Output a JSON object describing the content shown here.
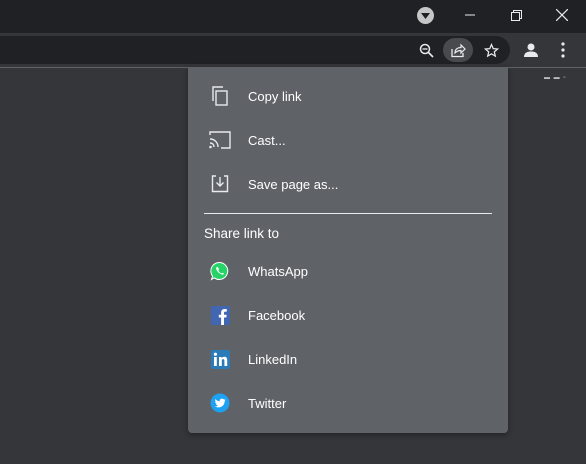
{
  "window": {
    "tab_search_icon": "chevron-down-icon",
    "minimize_icon": "minimize-icon",
    "restore_icon": "restore-icon",
    "close_icon": "close-icon"
  },
  "toolbar": {
    "zoom_icon": "zoom-out-icon",
    "share_icon": "share-icon",
    "bookmark_icon": "star-icon",
    "profile_icon": "person-icon",
    "menu_icon": "more-vertical-icon"
  },
  "share_menu": {
    "items": [
      {
        "label": "Copy link",
        "icon": "copy-icon"
      },
      {
        "label": "Cast...",
        "icon": "cast-icon"
      },
      {
        "label": "Save page as...",
        "icon": "download-icon"
      }
    ],
    "share_heading": "Share link to",
    "share_targets": [
      {
        "label": "WhatsApp",
        "icon": "whatsapp-icon",
        "color": "#25d366"
      },
      {
        "label": "Facebook",
        "icon": "facebook-icon",
        "color": "#4267b2"
      },
      {
        "label": "LinkedIn",
        "icon": "linkedin-icon",
        "color": "#2b7bb9"
      },
      {
        "label": "Twitter",
        "icon": "twitter-icon",
        "color": "#1da1f2"
      }
    ]
  },
  "colors": {
    "titlebar": "#202124",
    "toolbar": "#35363a",
    "menu_bg": "#5f6368"
  }
}
